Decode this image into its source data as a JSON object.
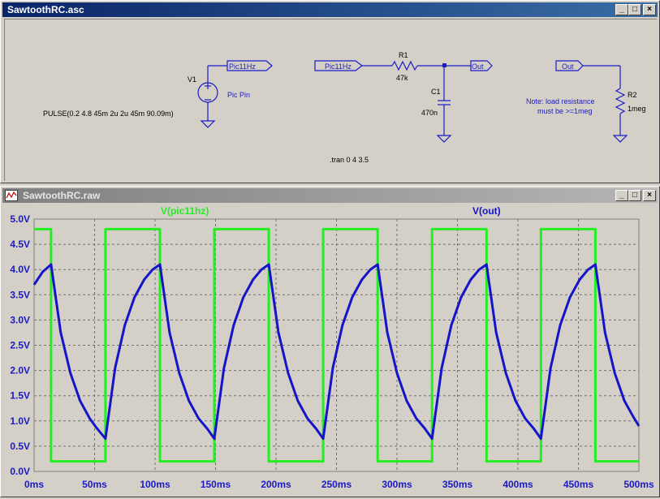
{
  "schematic_window": {
    "title": "SawtoothRC.asc",
    "buttons": {
      "minimize": "_",
      "maximize": "□",
      "close": "×"
    },
    "labels": {
      "net_pic_v1": "Pic11Hz",
      "v1_name": "V1",
      "v1_desc": "Pic Pin",
      "pulse": "PULSE(0.2 4.8 45m 2u 2u 45m 90.09m)",
      "net_pic_r1": "Pic11Hz",
      "r1_name": "R1",
      "r1_value": "47k",
      "c1_name": "C1",
      "c1_value": "470n",
      "net_out_c1": "Out",
      "net_out_r2": "Out",
      "note_line1": "Note: load resistance",
      "note_line2": "must be >=1meg",
      "r2_name": "R2",
      "r2_value": "1meg",
      "tran": ".tran 0 4 3.5"
    }
  },
  "plot_window": {
    "title": "SawtoothRC.raw",
    "buttons": {
      "minimize": "_",
      "maximize": "□",
      "close": "×"
    }
  },
  "chart_data": {
    "type": "line",
    "title": "",
    "xlabel": "",
    "ylabel": "",
    "xlim": [
      0,
      500
    ],
    "ylim": [
      0,
      5.0
    ],
    "x_ticks": [
      "0ms",
      "50ms",
      "100ms",
      "150ms",
      "200ms",
      "250ms",
      "300ms",
      "350ms",
      "400ms",
      "450ms",
      "500ms"
    ],
    "y_ticks": [
      "0.0V",
      "0.5V",
      "1.0V",
      "1.5V",
      "2.0V",
      "2.5V",
      "3.0V",
      "3.5V",
      "4.0V",
      "4.5V",
      "5.0V"
    ],
    "grid": true,
    "colors": {
      "pic": "#22ee22",
      "out": "#1414c8",
      "grid": "#707070",
      "background": "#d4d0c8"
    },
    "series": [
      {
        "name": "V(pic11hz)",
        "x": [
          0,
          14,
          14,
          59,
          59,
          104,
          104,
          149,
          149,
          194,
          194,
          239,
          239,
          284,
          284,
          329,
          329,
          374,
          374,
          419,
          419,
          464,
          464,
          500
        ],
        "values": [
          4.8,
          4.8,
          0.2,
          0.2,
          4.8,
          4.8,
          0.2,
          0.2,
          4.8,
          4.8,
          0.2,
          0.2,
          4.8,
          4.8,
          0.2,
          0.2,
          4.8,
          4.8,
          0.2,
          0.2,
          4.8,
          4.8,
          0.2,
          0.2
        ]
      },
      {
        "name": "V(out)",
        "x": [
          0,
          7,
          14,
          22,
          30,
          38,
          46,
          52,
          59,
          67,
          75,
          83,
          91,
          98,
          104,
          112,
          120,
          128,
          136,
          143,
          149,
          157,
          165,
          173,
          181,
          188,
          194,
          202,
          210,
          218,
          226,
          233,
          239,
          247,
          255,
          263,
          271,
          278,
          284,
          292,
          300,
          308,
          316,
          323,
          329,
          337,
          345,
          353,
          361,
          368,
          374,
          382,
          390,
          398,
          406,
          413,
          419,
          427,
          435,
          443,
          451,
          458,
          464,
          472,
          480,
          488,
          495,
          500
        ],
        "values": [
          3.7,
          3.95,
          4.1,
          2.75,
          1.95,
          1.4,
          1.05,
          0.85,
          0.65,
          2.05,
          2.9,
          3.45,
          3.8,
          4.0,
          4.1,
          2.75,
          1.95,
          1.4,
          1.05,
          0.85,
          0.65,
          2.05,
          2.9,
          3.45,
          3.8,
          4.0,
          4.1,
          2.75,
          1.95,
          1.4,
          1.05,
          0.85,
          0.65,
          2.05,
          2.9,
          3.45,
          3.8,
          4.0,
          4.1,
          2.75,
          1.95,
          1.4,
          1.05,
          0.85,
          0.65,
          2.05,
          2.9,
          3.45,
          3.8,
          4.0,
          4.1,
          2.75,
          1.95,
          1.4,
          1.05,
          0.85,
          0.65,
          2.05,
          2.9,
          3.45,
          3.8,
          4.0,
          4.1,
          2.75,
          1.95,
          1.4,
          1.1,
          0.9
        ]
      }
    ]
  }
}
